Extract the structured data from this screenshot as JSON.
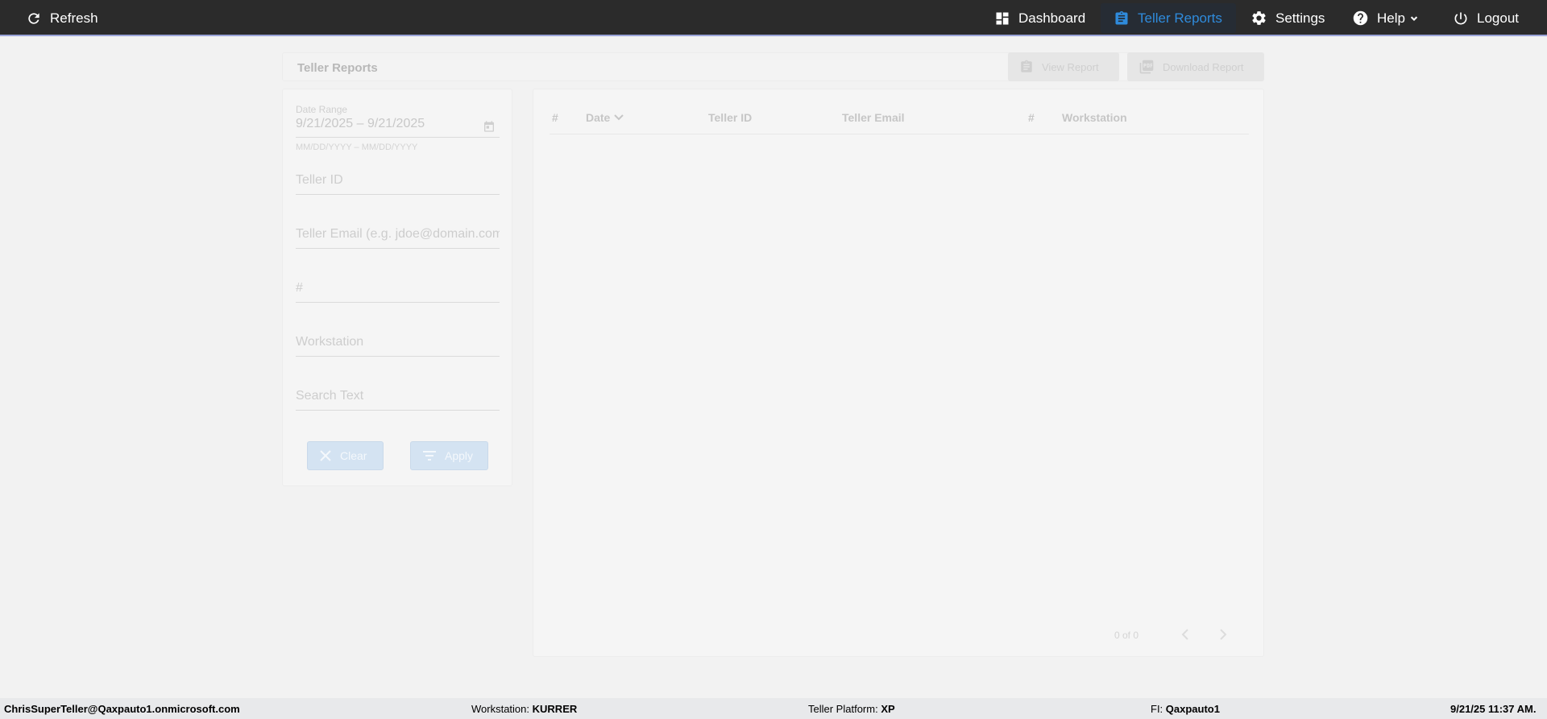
{
  "nav": {
    "refresh": "Refresh",
    "dashboard": "Dashboard",
    "teller_reports": "Teller Reports",
    "settings": "Settings",
    "help": "Help",
    "logout": "Logout"
  },
  "header": {
    "title": "Teller Reports",
    "view_report": "View Report",
    "download_report": "Download Report"
  },
  "filters": {
    "date_range_label": "Date Range",
    "date_range_value": "9/21/2025 – 9/21/2025",
    "date_range_hint": "MM/DD/YYYY – MM/DD/YYYY",
    "teller_id_placeholder": "Teller ID",
    "teller_email_placeholder": "Teller Email (e.g. jdoe@domain.com)",
    "number_placeholder": "#",
    "workstation_placeholder": "Workstation",
    "search_placeholder": "Search Text",
    "clear_label": "Clear",
    "apply_label": "Apply"
  },
  "table": {
    "columns": [
      "#",
      "Date",
      "Teller ID",
      "Teller Email",
      "#",
      "Workstation"
    ],
    "rows": [],
    "pagination": "0 of 0"
  },
  "footer": {
    "user": "ChrisSuperTeller@Qaxpauto1.onmicrosoft.com",
    "workstation_label": "Workstation:",
    "workstation_value": "KURRER",
    "platform_label": "Teller Platform:",
    "platform_value": "XP",
    "fi_label": "FI:",
    "fi_value": "Qaxpauto1",
    "datetime": "9/21/25 11:37 AM."
  },
  "colors": {
    "topbar": "#2b2b2b",
    "active_nav": "#2f8bdc",
    "footer": "#e8e9eb"
  }
}
